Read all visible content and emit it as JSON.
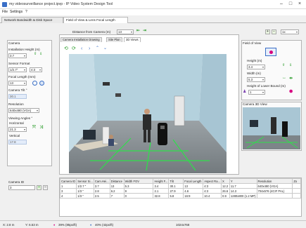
{
  "window": {
    "title": "my videosurveillance project.ipvp - IP Video System Design Tool"
  },
  "menu": [
    "File",
    "Settings",
    "?"
  ],
  "tabs": [
    "Network Bandwidth & Disk Space",
    "Field of View & Lens Focal Length"
  ],
  "distance": {
    "label": "Distance from Camera (m)",
    "value": "13"
  },
  "zoom": {
    "value": "1x"
  },
  "camera": {
    "section_title": "Camera",
    "install_height_label": "Installation Height (m)",
    "install_height_value": "3.7",
    "sensor_label": "Sensor Format",
    "sensor_value": "1/2.7\"",
    "sensor_ratio": "4:3",
    "focal_label": "Focal Length (mm)",
    "focal_value": "13",
    "tilt_label": "Camera Tilt °",
    "tilt_value": "30.1",
    "resolution_label": "Resolution",
    "resolution_value": "640x480 (VGA)",
    "angles_label": "Viewing Angles °",
    "horizontal_label": "Horizontal",
    "horizontal_value": "21.3",
    "vertical_label": "Vertical",
    "vertical_value": "17.8"
  },
  "view_tabs": [
    "Camera Installation Drawing",
    "Site Plan",
    "3D Views"
  ],
  "field_of_view": {
    "title": "Field of View",
    "height_label": "Height (m)",
    "height_value": "3.4",
    "width_label": "Width (m)",
    "width_value": "5.3",
    "lower_bound_label": "Height of Lower Bound (m)",
    "lower_bound_value": "1"
  },
  "camera_3d": {
    "title": "Camera 3D View"
  },
  "camera_id": {
    "label": "Camera ID",
    "value": "3"
  },
  "table": {
    "headers": [
      "Camera ID",
      "Sensor Si...",
      "Cam.Hei...",
      "Distance",
      "Width FOV",
      "Height F...",
      "Tilt",
      "Focal Length",
      "Aspect Ra...",
      "X",
      "Y",
      "Resolution",
      "Zo"
    ],
    "rows": [
      [
        "1",
        "1/2.7 \"",
        "3.7",
        "13",
        "5.3",
        "3.4",
        "30.1",
        "13",
        "4:3",
        "12.2",
        "11.7",
        "640x480 (VGA)",
        ""
      ],
      [
        "3",
        "1/3 \"",
        "2.8",
        "6.2",
        "9",
        "2.1",
        "27.9",
        "4.6",
        "4:3",
        "26.6",
        "14.3",
        "704x576 (4CIF PAL)",
        ""
      ],
      [
        "4",
        "1/3 \"",
        "2.5",
        "7",
        "0",
        "32.8",
        "5.8",
        "16:9",
        "10.4",
        "0.9",
        "1280x800 (1.2 MP)",
        "",
        ""
      ]
    ]
  },
  "status": {
    "x": "X: 2.8 m",
    "y": "Y: 6.53 m",
    "pct1": "39% (85px/ft)",
    "pct2": "40% (42px/ft)",
    "res": "1024x768"
  },
  "colors": {
    "accent_green": "#2e9e2e",
    "fov_blue": "#3a6fc7",
    "magenta_marker": "#d6007f",
    "floor": "#8a9094",
    "walls": "#b3cfdc"
  }
}
